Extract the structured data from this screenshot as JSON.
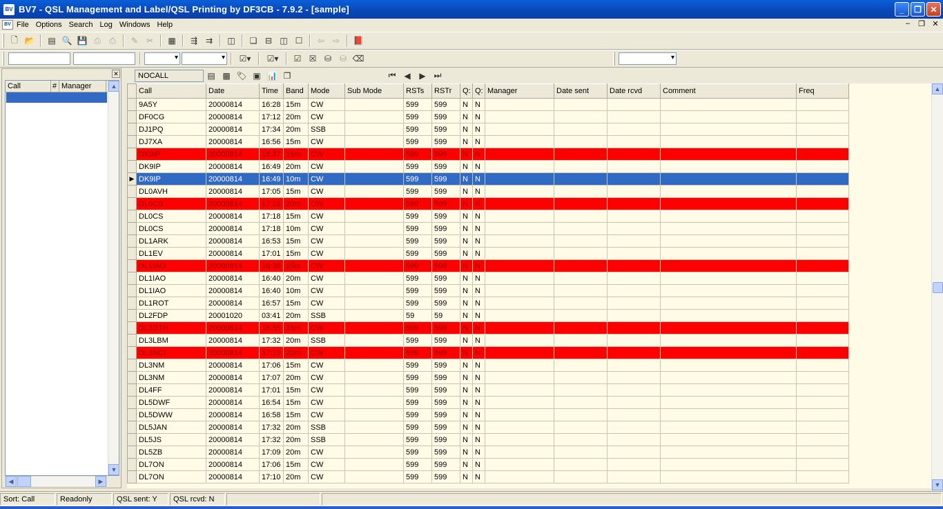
{
  "window": {
    "title": "BV7 - QSL Management and Label/QSL Printing by DF3CB - 7.9.2  - [sample]",
    "app_icon": "BV"
  },
  "menu": [
    "File",
    "Options",
    "Search",
    "Log",
    "Windows",
    "Help"
  ],
  "left_panel": {
    "columns": [
      "Call",
      "#",
      "Manager"
    ]
  },
  "grid_toolbar": {
    "filter_field": "NOCALL"
  },
  "grid": {
    "columns": [
      "Call",
      "Date",
      "Time",
      "Band",
      "Mode",
      "Sub Mode",
      "RSTs",
      "RSTr",
      "Q:",
      "Q:",
      "Manager",
      "Date sent",
      "Date rcvd",
      "Comment",
      "Freq"
    ],
    "rows": [
      {
        "call": "9A5Y",
        "date": "20000814",
        "time": "16:28",
        "band": "15m",
        "mode": "CW",
        "rsts": "599",
        "rstr": "599",
        "qs": "N",
        "qr": "N",
        "state": "normal"
      },
      {
        "call": "DF0CG",
        "date": "20000814",
        "time": "17:12",
        "band": "20m",
        "mode": "CW",
        "rsts": "599",
        "rstr": "599",
        "qs": "N",
        "qr": "N",
        "state": "normal"
      },
      {
        "call": "DJ1PQ",
        "date": "20000814",
        "time": "17:34",
        "band": "20m",
        "mode": "SSB",
        "rsts": "599",
        "rstr": "599",
        "qs": "N",
        "qr": "N",
        "state": "normal"
      },
      {
        "call": "DJ7XA",
        "date": "20000814",
        "time": "16:56",
        "band": "15m",
        "mode": "CW",
        "rsts": "599",
        "rstr": "599",
        "qs": "N",
        "qr": "N",
        "state": "normal"
      },
      {
        "call": "DK9IP",
        "date": "20000814",
        "time": "16:37",
        "band": "15m",
        "mode": "CW",
        "rsts": "599",
        "rstr": "599",
        "qs": "N",
        "qr": "N",
        "state": "red"
      },
      {
        "call": "DK9IP",
        "date": "20000814",
        "time": "16:49",
        "band": "20m",
        "mode": "CW",
        "rsts": "599",
        "rstr": "599",
        "qs": "N",
        "qr": "N",
        "state": "normal"
      },
      {
        "call": "DK9IP",
        "date": "20000814",
        "time": "16:49",
        "band": "10m",
        "mode": "CW",
        "rsts": "599",
        "rstr": "599",
        "qs": "N",
        "qr": "N",
        "state": "selected"
      },
      {
        "call": "DL0AVH",
        "date": "20000814",
        "time": "17:05",
        "band": "15m",
        "mode": "CW",
        "rsts": "599",
        "rstr": "599",
        "qs": "N",
        "qr": "N",
        "state": "normal"
      },
      {
        "call": "DL0CS",
        "date": "20000814",
        "time": "17:15",
        "band": "20m",
        "mode": "CW",
        "rsts": "599",
        "rstr": "599",
        "qs": "N",
        "qr": "N",
        "state": "red"
      },
      {
        "call": "DL0CS",
        "date": "20000814",
        "time": "17:18",
        "band": "15m",
        "mode": "CW",
        "rsts": "599",
        "rstr": "599",
        "qs": "N",
        "qr": "N",
        "state": "normal"
      },
      {
        "call": "DL0CS",
        "date": "20000814",
        "time": "17:18",
        "band": "10m",
        "mode": "CW",
        "rsts": "599",
        "rstr": "599",
        "qs": "N",
        "qr": "N",
        "state": "normal"
      },
      {
        "call": "DL1ARK",
        "date": "20000814",
        "time": "16:53",
        "band": "15m",
        "mode": "CW",
        "rsts": "599",
        "rstr": "599",
        "qs": "N",
        "qr": "N",
        "state": "normal"
      },
      {
        "call": "DL1EV",
        "date": "20000814",
        "time": "17:01",
        "band": "15m",
        "mode": "CW",
        "rsts": "599",
        "rstr": "599",
        "qs": "N",
        "qr": "N",
        "state": "normal"
      },
      {
        "call": "DL1IAO",
        "date": "20000814",
        "time": "16:38",
        "band": "15m",
        "mode": "CW",
        "rsts": "599",
        "rstr": "599",
        "qs": "N",
        "qr": "N",
        "state": "red"
      },
      {
        "call": "DL1IAO",
        "date": "20000814",
        "time": "16:40",
        "band": "20m",
        "mode": "CW",
        "rsts": "599",
        "rstr": "599",
        "qs": "N",
        "qr": "N",
        "state": "normal"
      },
      {
        "call": "DL1IAO",
        "date": "20000814",
        "time": "16:40",
        "band": "10m",
        "mode": "CW",
        "rsts": "599",
        "rstr": "599",
        "qs": "N",
        "qr": "N",
        "state": "normal"
      },
      {
        "call": "DL1ROT",
        "date": "20000814",
        "time": "16:57",
        "band": "15m",
        "mode": "CW",
        "rsts": "599",
        "rstr": "599",
        "qs": "N",
        "qr": "N",
        "state": "normal"
      },
      {
        "call": "DL2FDP",
        "date": "20001020",
        "time": "03:41",
        "band": "20m",
        "mode": "SSB",
        "rsts": "59",
        "rstr": "59",
        "qs": "N",
        "qr": "N",
        "state": "normal"
      },
      {
        "call": "DL3DTH",
        "date": "20000814",
        "time": "16:55",
        "band": "15m",
        "mode": "CW",
        "rsts": "599",
        "rstr": "599",
        "qs": "N",
        "qr": "N",
        "state": "red"
      },
      {
        "call": "DL3LBM",
        "date": "20000814",
        "time": "17:32",
        "band": "20m",
        "mode": "SSB",
        "rsts": "599",
        "rstr": "599",
        "qs": "N",
        "qr": "N",
        "state": "normal"
      },
      {
        "call": "DL3NCI",
        "date": "20000814",
        "time": "17:10",
        "band": "20m",
        "mode": "CW",
        "rsts": "599",
        "rstr": "599",
        "qs": "N",
        "qr": "N",
        "state": "red"
      },
      {
        "call": "DL3NM",
        "date": "20000814",
        "time": "17:06",
        "band": "15m",
        "mode": "CW",
        "rsts": "599",
        "rstr": "599",
        "qs": "N",
        "qr": "N",
        "state": "normal"
      },
      {
        "call": "DL3NM",
        "date": "20000814",
        "time": "17:07",
        "band": "20m",
        "mode": "CW",
        "rsts": "599",
        "rstr": "599",
        "qs": "N",
        "qr": "N",
        "state": "normal"
      },
      {
        "call": "DL4FF",
        "date": "20000814",
        "time": "17:01",
        "band": "15m",
        "mode": "CW",
        "rsts": "599",
        "rstr": "599",
        "qs": "N",
        "qr": "N",
        "state": "normal"
      },
      {
        "call": "DL5DWF",
        "date": "20000814",
        "time": "16:54",
        "band": "15m",
        "mode": "CW",
        "rsts": "599",
        "rstr": "599",
        "qs": "N",
        "qr": "N",
        "state": "normal"
      },
      {
        "call": "DL5DWW",
        "date": "20000814",
        "time": "16:58",
        "band": "15m",
        "mode": "CW",
        "rsts": "599",
        "rstr": "599",
        "qs": "N",
        "qr": "N",
        "state": "normal"
      },
      {
        "call": "DL5JAN",
        "date": "20000814",
        "time": "17:32",
        "band": "20m",
        "mode": "SSB",
        "rsts": "599",
        "rstr": "599",
        "qs": "N",
        "qr": "N",
        "state": "normal"
      },
      {
        "call": "DL5JS",
        "date": "20000814",
        "time": "17:32",
        "band": "20m",
        "mode": "SSB",
        "rsts": "599",
        "rstr": "599",
        "qs": "N",
        "qr": "N",
        "state": "normal"
      },
      {
        "call": "DL5ZB",
        "date": "20000814",
        "time": "17:09",
        "band": "20m",
        "mode": "CW",
        "rsts": "599",
        "rstr": "599",
        "qs": "N",
        "qr": "N",
        "state": "normal"
      },
      {
        "call": "DL7ON",
        "date": "20000814",
        "time": "17:06",
        "band": "15m",
        "mode": "CW",
        "rsts": "599",
        "rstr": "599",
        "qs": "N",
        "qr": "N",
        "state": "normal"
      },
      {
        "call": "DL7ON",
        "date": "20000814",
        "time": "17:10",
        "band": "20m",
        "mode": "CW",
        "rsts": "599",
        "rstr": "599",
        "qs": "N",
        "qr": "N",
        "state": "normal"
      }
    ]
  },
  "status": {
    "sort": "Sort: Call",
    "mode": "Readonly",
    "qsl_sent": "QSL sent: Y",
    "qsl_rcvd": "QSL rcvd: N"
  },
  "colors": {
    "red_row": "#ff0000",
    "selected_row": "#316ac5",
    "grid_bg": "#fffbe7"
  }
}
